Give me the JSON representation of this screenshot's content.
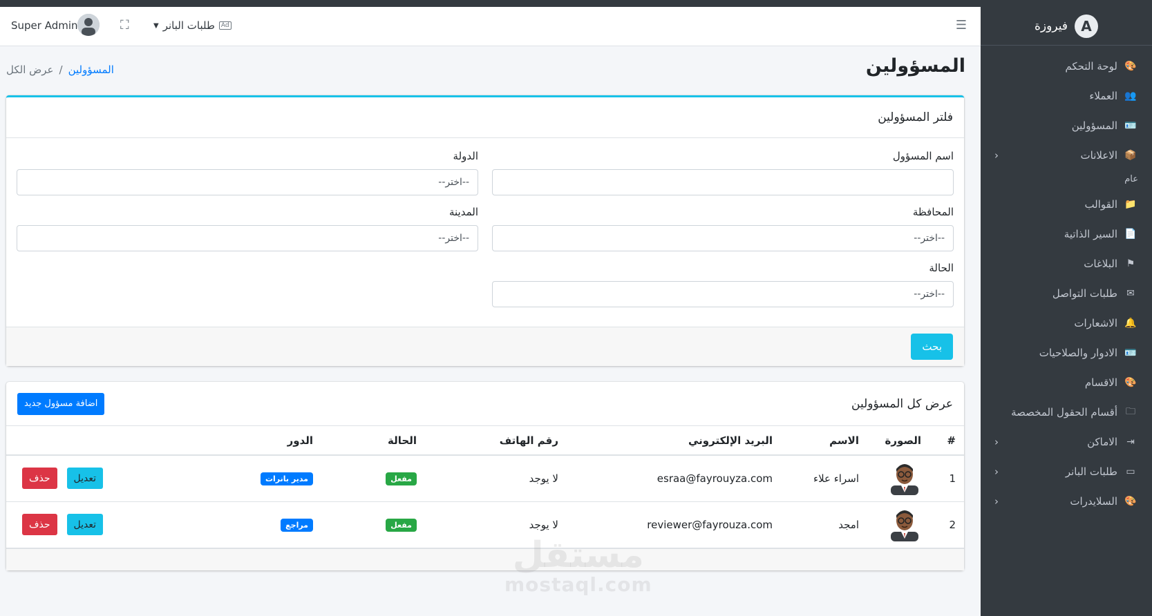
{
  "brand": {
    "name": "فيروزة",
    "logo_letter": "A"
  },
  "sidebar": {
    "items": [
      {
        "label": "لوحة التحكم",
        "icon": "palette-icon",
        "glyph": "🎨",
        "chevron": false
      },
      {
        "label": "العملاء",
        "icon": "users-icon",
        "glyph": "👥",
        "chevron": false
      },
      {
        "label": "المسؤولين",
        "icon": "id-card-icon",
        "glyph": "🪪",
        "chevron": false
      },
      {
        "label": "الاعلانات",
        "icon": "box-icon",
        "glyph": "📦",
        "chevron": true
      }
    ],
    "section_header": "عام",
    "items2": [
      {
        "label": "القوالب",
        "icon": "folder-icon",
        "glyph": "📁",
        "chevron": false
      },
      {
        "label": "السير الذاتية",
        "icon": "resume-icon",
        "glyph": "📄",
        "chevron": false
      },
      {
        "label": "البلاغات",
        "icon": "flag-icon",
        "glyph": "⚑",
        "chevron": false
      },
      {
        "label": "طلبات التواصل",
        "icon": "envelope-icon",
        "glyph": "✉",
        "chevron": false
      },
      {
        "label": "الاشعارات",
        "icon": "bell-icon",
        "glyph": "🔔",
        "chevron": false
      },
      {
        "label": "الادوار والصلاحيات",
        "icon": "id-card-icon",
        "glyph": "🪪",
        "chevron": false
      },
      {
        "label": "الاقسام",
        "icon": "palette-icon",
        "glyph": "🎨",
        "chevron": false
      },
      {
        "label": "أقسام الحقول المخصصة",
        "icon": "folder-plus-icon",
        "glyph": "🗀",
        "chevron": false
      },
      {
        "label": "الاماكن",
        "icon": "sign-in-icon",
        "glyph": "⇥",
        "chevron": true
      },
      {
        "label": "طلبات البانر",
        "icon": "ad-icon",
        "glyph": "▭",
        "chevron": true
      },
      {
        "label": "السلايدرات",
        "icon": "palette-icon",
        "glyph": "🎨",
        "chevron": true
      }
    ]
  },
  "topnav": {
    "user_name": "Super Admin",
    "banner_dropdown_label": "طلبات البانر",
    "ad_badge": "Ad"
  },
  "page": {
    "title": "المسؤولين",
    "breadcrumb": {
      "link": "المسؤولين",
      "separator": "/",
      "current": "عرض الكل"
    }
  },
  "filter": {
    "header": "فلتر المسؤولين",
    "fields": {
      "admin_name": {
        "label": "اسم المسؤول",
        "value": ""
      },
      "country": {
        "label": "الدولة",
        "value": "--اختر--"
      },
      "governorate": {
        "label": "المحافظة",
        "value": "--اختر--"
      },
      "city": {
        "label": "المدينة",
        "value": "--اختر--"
      },
      "status": {
        "label": "الحالة",
        "value": "--اختر--"
      }
    },
    "search_button": "بحث"
  },
  "list": {
    "header": "عرض كل المسؤولين",
    "add_button": "اضافة مسؤول جديد",
    "columns": [
      "#",
      "الصورة",
      "الاسم",
      "البريد الإلكتروني",
      "رقم الهاتف",
      "الحالة",
      "الدور",
      ""
    ],
    "rows": [
      {
        "index": "1",
        "name": "اسراء علاء",
        "email": "esraa@fayrouyza.com",
        "phone": "لا يوجد",
        "status": "مفعل",
        "role": "مدير بانرات",
        "edit": "تعديل",
        "delete": "حذف"
      },
      {
        "index": "2",
        "name": "امجد",
        "email": "reviewer@fayrouza.com",
        "phone": "لا يوجد",
        "status": "مفعل",
        "role": "مراجع",
        "edit": "تعديل",
        "delete": "حذف"
      }
    ]
  },
  "watermark": {
    "arabic": "مستقل",
    "latin": "mostaql.com"
  },
  "colors": {
    "sidebar_bg": "#343a40",
    "accent_cyan": "#17c1e8",
    "primary_blue": "#007bff",
    "success_green": "#28a745",
    "danger_red": "#dc3545"
  }
}
